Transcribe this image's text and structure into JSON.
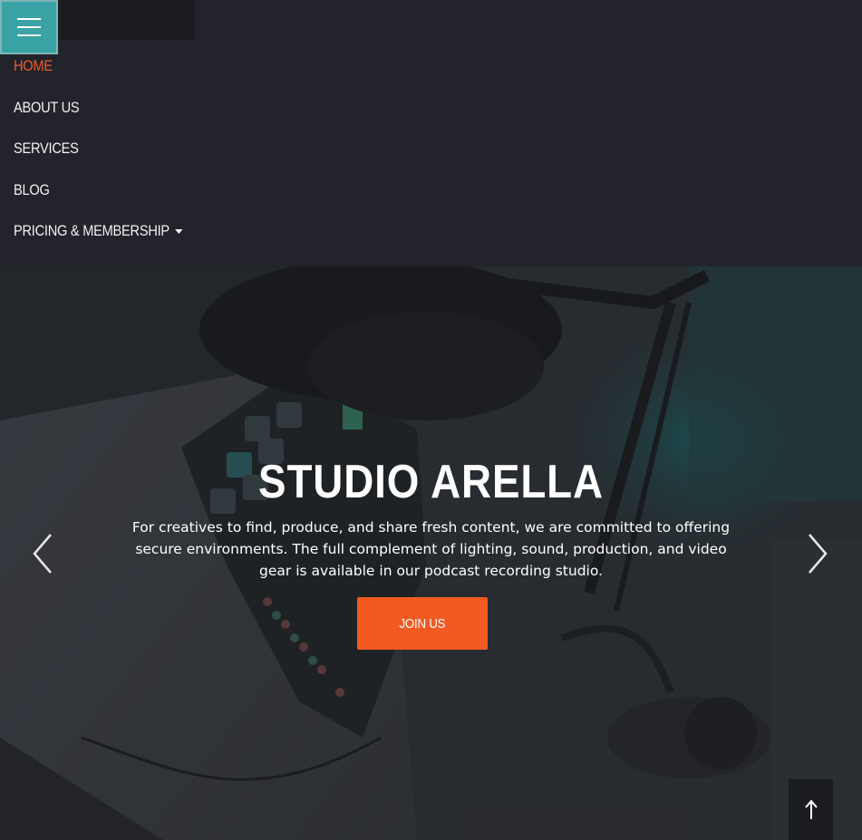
{
  "menu_toggle": {
    "icon": "hamburger-icon",
    "color": "#3aa3a6"
  },
  "nav": {
    "items": [
      {
        "label": "HOME",
        "active": true
      },
      {
        "label": "ABOUT US",
        "active": false
      },
      {
        "label": "SERVICES",
        "active": false
      },
      {
        "label": "BLOG",
        "active": false
      },
      {
        "label": "PRICING & MEMBERSHIP",
        "active": false,
        "icon": "caret-down-icon"
      }
    ],
    "active_color": "#f05a28"
  },
  "hero": {
    "title": "STUDIO ARELLA",
    "description": "For creatives to find, produce, and share fresh content, we are committed to offering secure environments. The full complement of lighting, sound, production, and video gear is available in our podcast recording studio.",
    "cta_label": "JOIN US",
    "cta_color": "#f25a22",
    "prev_icon": "chevron-left-icon",
    "next_icon": "chevron-right-icon"
  },
  "back_to_top": {
    "icon": "arrow-up-icon"
  }
}
